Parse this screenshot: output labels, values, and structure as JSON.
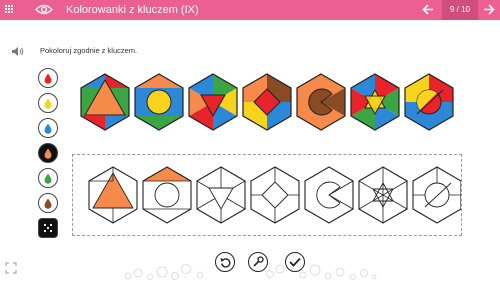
{
  "header": {
    "title": "Kolorowanki z kluczem (IX)",
    "counter": "9 / 10",
    "icons": [
      "apps-grid-icon",
      "eye-icon",
      "arrow-left-icon",
      "arrow-right-icon"
    ],
    "background_color": "#ec5f91"
  },
  "instruction": "Pokoloruj zgodnie z kluczem.",
  "palette": {
    "items": [
      {
        "name": "red",
        "color": "#e8232a",
        "selected": false
      },
      {
        "name": "yellow",
        "color": "#f6d31c",
        "selected": false
      },
      {
        "name": "blue",
        "color": "#2d88d8",
        "selected": false
      },
      {
        "name": "orange",
        "color": "#f58a4b",
        "selected": true
      },
      {
        "name": "green",
        "color": "#3ba443",
        "selected": false
      },
      {
        "name": "brown",
        "color": "#8a4a22",
        "selected": false
      },
      {
        "name": "random",
        "color": "#111111",
        "selected": false
      }
    ]
  },
  "key_patterns": 7,
  "target_patterns": 7,
  "bottom_buttons": [
    "undo-icon",
    "hint-icon",
    "check-icon"
  ]
}
